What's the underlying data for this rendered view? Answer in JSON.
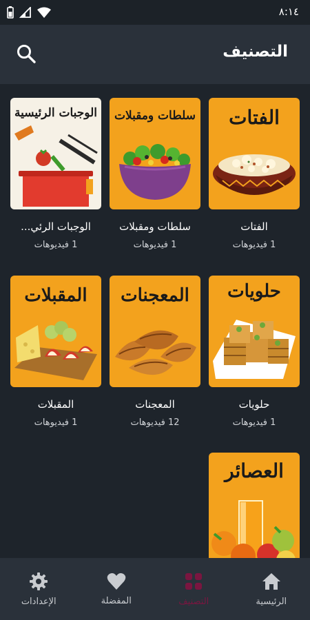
{
  "status_bar": {
    "time": "٨:١٤"
  },
  "app_bar": {
    "title": "التصنيف"
  },
  "categories": [
    {
      "name": "الفتات",
      "thumb_title": "الفتات",
      "count": "1 فيديوهات"
    },
    {
      "name": "سلطات ومقبلات",
      "thumb_title": "سلطات ومقبلات",
      "count": "1 فيديوهات"
    },
    {
      "name": "الوجبات الرئي...",
      "thumb_title": "الوجبات الرئيسية",
      "count": "1 فيديوهات"
    },
    {
      "name": "حلويات",
      "thumb_title": "حلويات",
      "count": "1 فيديوهات"
    },
    {
      "name": "المعجنات",
      "thumb_title": "المعجنات",
      "count": "12 فيديوهات"
    },
    {
      "name": "المقبلات",
      "thumb_title": "المقبلات",
      "count": "1 فيديوهات"
    },
    {
      "name": "العصائر",
      "thumb_title": "العصائر",
      "count": ""
    }
  ],
  "bottom_nav": {
    "items": [
      {
        "label": "الرئيسية",
        "icon": "home-icon",
        "active": false
      },
      {
        "label": "التصنيف",
        "icon": "grid-icon",
        "active": true
      },
      {
        "label": "المفضلة",
        "icon": "heart-icon",
        "active": false
      },
      {
        "label": "الإعدادات",
        "icon": "gear-icon",
        "active": false
      }
    ]
  },
  "colors": {
    "background": "#1e242b",
    "bar": "#2a313a",
    "card": "#f3a21d",
    "active": "#7a1640"
  }
}
